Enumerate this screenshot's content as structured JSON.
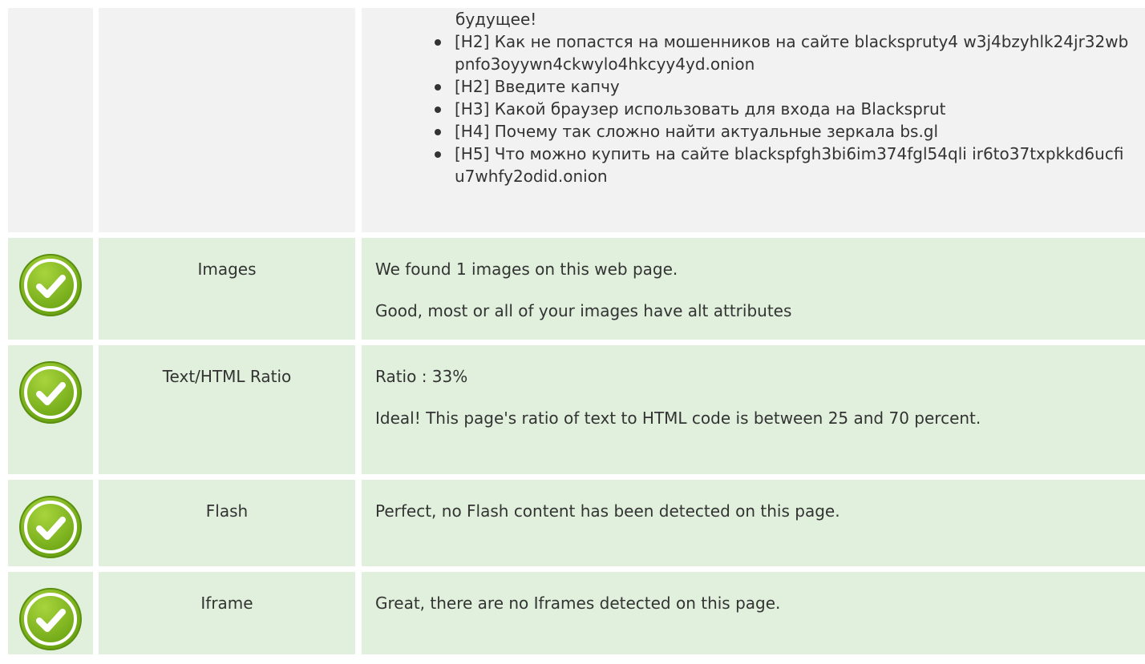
{
  "headings": {
    "continuation": "будущее!",
    "items": [
      "[H2] Как не попастся на мошенников на сайте blackspruty4 w3j4bzyhlk24jr32wbpnfo3oyywn4ckwylo4hkcyy4yd.onion",
      "[H2] Введите капчу",
      "[H3] Какой браузер использовать для входа на Blacksprut",
      "[H4] Почему так сложно найти актуальные зеркала bs.gl",
      "[H5] Что можно купить на сайте blackspfgh3bi6im374fgl54qli ir6to37txpkkd6ucfiu7whfy2odid.onion"
    ]
  },
  "checks": [
    {
      "status_icon": "check-circle-icon",
      "label": "Images",
      "lines": [
        "We found 1 images on this web page.",
        "Good, most or all of your images have alt attributes"
      ]
    },
    {
      "status_icon": "check-circle-icon",
      "label": "Text/HTML Ratio",
      "lines": [
        "Ratio : 33%",
        "Ideal! This page's ratio of text to HTML code is between 25 and 70 percent."
      ]
    },
    {
      "status_icon": "check-circle-icon",
      "label": "Flash",
      "lines": [
        "Perfect, no Flash content has been detected on this page."
      ]
    },
    {
      "status_icon": "check-circle-icon",
      "label": "Iframe",
      "lines": [
        "Great, there are no Iframes detected on this page."
      ]
    }
  ],
  "colors": {
    "row_pass_bg": "#e0f0dc",
    "row_neutral_bg": "#f2f2f2",
    "check_green": "#7ab51d"
  }
}
